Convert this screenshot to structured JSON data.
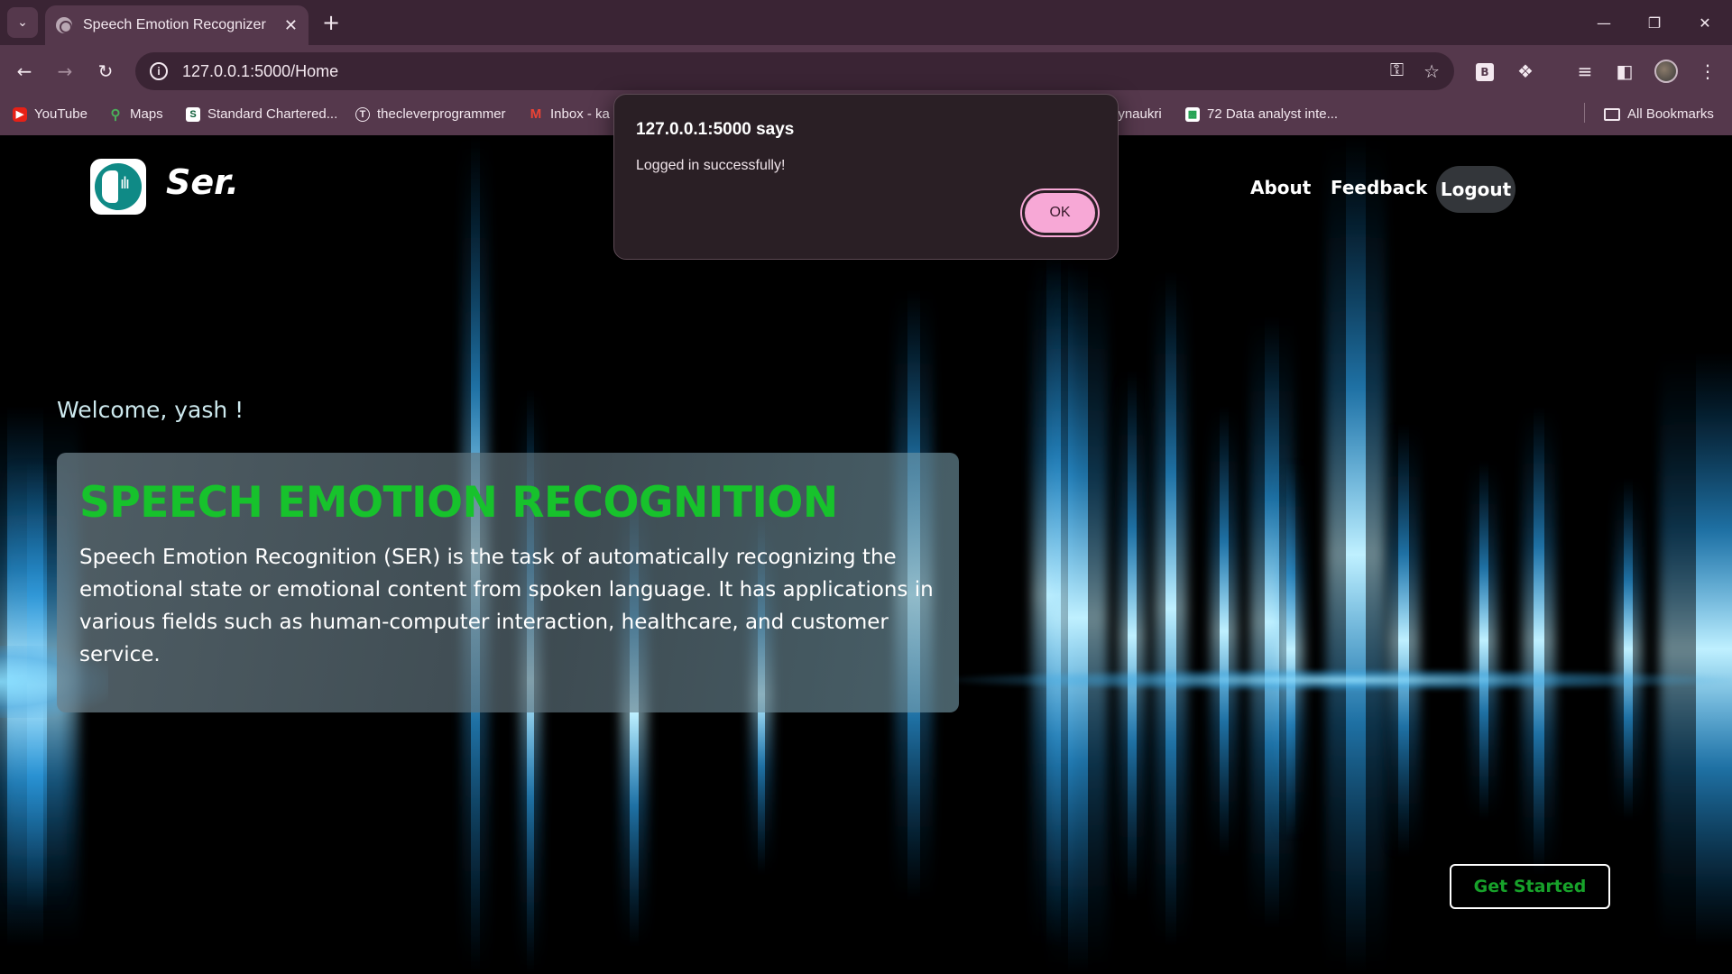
{
  "browser": {
    "tab_title": "Speech Emotion Recognizer",
    "url": "127.0.0.1:5000/Home",
    "bookmarks": [
      {
        "label": "YouTube",
        "icon": "youtube-icon"
      },
      {
        "label": "Maps",
        "icon": "maps-icon"
      },
      {
        "label": "Standard Chartered...",
        "icon": "standard-chartered-icon"
      },
      {
        "label": "thecleverprogrammer",
        "icon": "t-circle-icon"
      },
      {
        "label": "Inbox - ka",
        "icon": "gmail-icon"
      },
      {
        "label": "lynaukri",
        "icon": ""
      },
      {
        "label": "72 Data analyst inte...",
        "icon": "sheet-icon"
      }
    ],
    "all_bookmarks": "All Bookmarks",
    "extension_label": "B"
  },
  "site": {
    "brand": "Ser.",
    "nav": {
      "about": "About",
      "feedback": "Feedback",
      "logout": "Logout"
    },
    "welcome": "Welcome, yash !",
    "hero_title": "SPEECH EMOTION RECOGNITION",
    "hero_text": "Speech Emotion Recognition (SER) is the task of automatically recognizing the emotional state or emotional content from spoken language. It has applications in various fields such as human-computer interaction, healthcare, and customer service.",
    "cta": "Get Started"
  },
  "dialog": {
    "title": "127.0.0.1:5000 says",
    "message": "Logged in successfully!",
    "ok": "OK"
  },
  "colors": {
    "browser_frame": "#3a2434",
    "toolbar": "#55384c",
    "hero_title": "#17c22c",
    "cta_text": "#17a22a",
    "wave_blue": "#3fb8f0",
    "dialog_ok": "#f7a8d6"
  }
}
